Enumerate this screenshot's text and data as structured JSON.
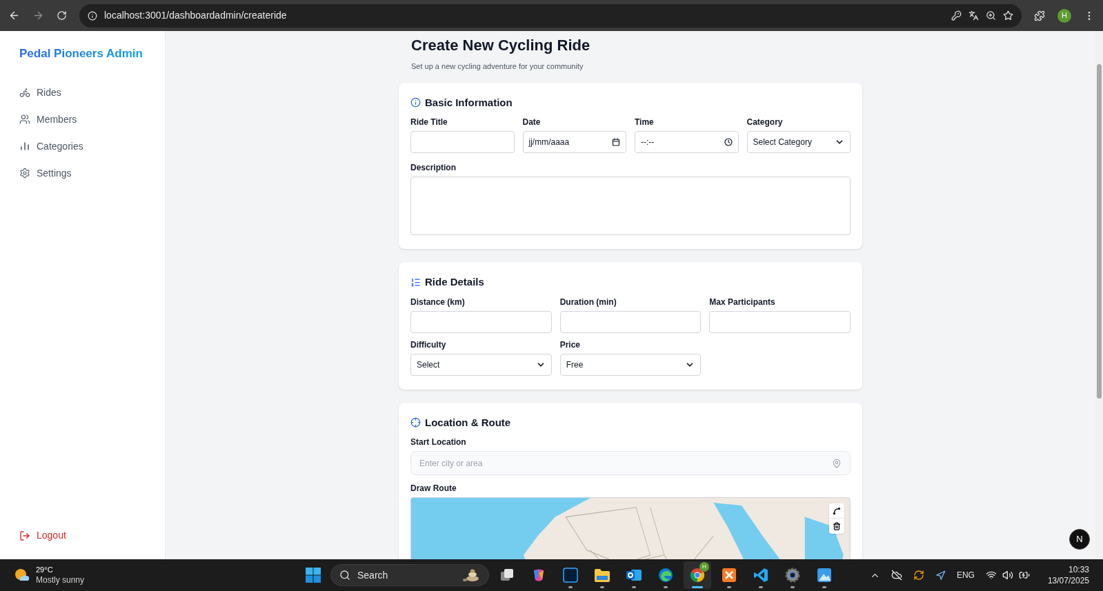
{
  "browser": {
    "url": "localhost:3001/dashboardadmin/createride",
    "profile_initial": "H"
  },
  "sidebar": {
    "brand": "Pedal Pioneers Admin",
    "items": [
      {
        "label": "Rides"
      },
      {
        "label": "Members"
      },
      {
        "label": "Categories"
      },
      {
        "label": "Settings"
      }
    ],
    "logout": "Logout"
  },
  "page": {
    "title": "Create New Cycling Ride",
    "subtitle": "Set up a new cycling adventure for your community"
  },
  "sections": [
    {
      "kind": "basic",
      "title": "Basic Information",
      "fields": [
        {
          "kind": "text",
          "label": "Ride Title"
        },
        {
          "kind": "date",
          "label": "Date",
          "placeholder": "jj/mm/aaaa"
        },
        {
          "kind": "time",
          "label": "Time",
          "placeholder": "--:--"
        },
        {
          "kind": "select",
          "label": "Category",
          "value": "Select Category"
        },
        {
          "kind": "textarea",
          "label": "Description"
        }
      ]
    },
    {
      "kind": "details",
      "title": "Ride Details",
      "fields": [
        {
          "kind": "text",
          "label": "Distance (km)"
        },
        {
          "kind": "text",
          "label": "Duration (min)"
        },
        {
          "kind": "text",
          "label": "Max Participants"
        },
        {
          "kind": "select",
          "label": "Difficulty",
          "value": "Select"
        },
        {
          "kind": "select",
          "label": "Price",
          "value": "Free"
        }
      ]
    },
    {
      "kind": "location",
      "title": "Location & Route",
      "fields": [
        {
          "kind": "location",
          "label": "Start Location",
          "placeholder": "Enter city or area"
        },
        {
          "kind": "map",
          "label": "Draw Route"
        }
      ]
    }
  ],
  "dev_badge": "N",
  "taskbar": {
    "weather": {
      "temperature": "29°C",
      "condition": "Mostly sunny"
    },
    "search_label": "Search",
    "apps": [
      {
        "kind": "start"
      },
      {
        "kind": "taskview"
      },
      {
        "kind": "copilot"
      },
      {
        "kind": "photoshop",
        "open": true,
        "active": false
      },
      {
        "kind": "explorer",
        "open": true,
        "active": false
      },
      {
        "kind": "outlook",
        "open": true,
        "active": false
      },
      {
        "kind": "edge",
        "open": true,
        "active": false
      },
      {
        "kind": "chrome",
        "open": true,
        "active": true,
        "badge": "H"
      },
      {
        "kind": "xampp",
        "open": true,
        "active": false
      },
      {
        "kind": "vscode",
        "open": true,
        "active": false
      },
      {
        "kind": "settings",
        "open": true,
        "active": false
      },
      {
        "kind": "photos",
        "open": true,
        "active": false
      }
    ],
    "language": "ENG",
    "time": "10:33",
    "date": "13/07/2025"
  }
}
